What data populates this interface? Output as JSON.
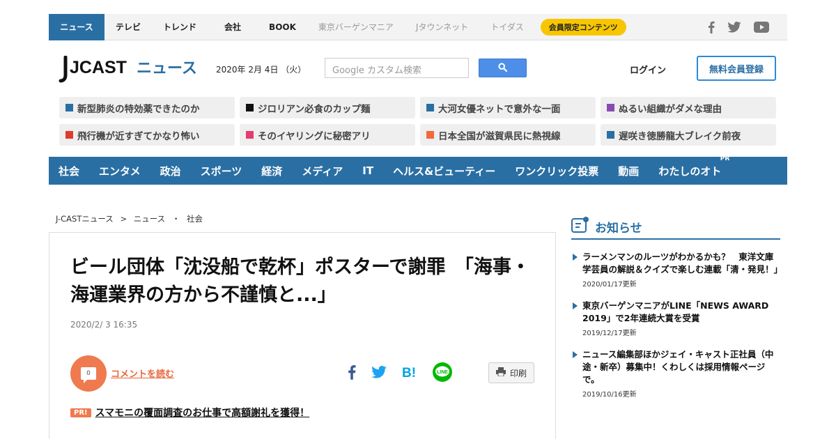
{
  "topnav": {
    "items": [
      {
        "label": "ニュース"
      },
      {
        "label": "テレビ"
      },
      {
        "label": "トレンド"
      },
      {
        "label": "会社"
      },
      {
        "label": "BOOK"
      },
      {
        "label": "東京バーゲンマニア"
      },
      {
        "label": "Jタウンネット"
      },
      {
        "label": "トイダス"
      }
    ],
    "members_label": "会員限定コンテンツ"
  },
  "header": {
    "logo_text": "JCAST",
    "logo_sub": "ニュース",
    "date": "2020年 2月 4日 （火）",
    "search_placeholder": "Google カスタム検索",
    "login_label": "ログイン",
    "signup_label": "無料会員登録"
  },
  "chips": [
    {
      "label": "新型肺炎の特効薬できたのか",
      "color": "#2a6fa4"
    },
    {
      "label": "ジロリアン必食のカップ麺",
      "color": "#111111"
    },
    {
      "label": "大河女優ネットで意外な一面",
      "color": "#2a6fa4"
    },
    {
      "label": "ぬるい組織がダメな理由",
      "color": "#8a4bb5"
    },
    {
      "label": "飛行機が近すぎてかなり怖い",
      "color": "#e03a2f"
    },
    {
      "label": "そのイヤリングに秘密アリ",
      "color": "#e63b6f"
    },
    {
      "label": "日本全国が滋賀県民に熱視線",
      "color": "#f06a3a"
    },
    {
      "label": "遅咲き徳勝龍大ブレイク前夜",
      "color": "#2a6fa4"
    }
  ],
  "categories": [
    {
      "label": "社会"
    },
    {
      "label": "エンタメ"
    },
    {
      "label": "政治"
    },
    {
      "label": "スポーツ"
    },
    {
      "label": "経済"
    },
    {
      "label": "メディア"
    },
    {
      "label": "IT"
    },
    {
      "label": "ヘルス&ビューティー"
    },
    {
      "label": "ワンクリック投票"
    },
    {
      "label": "動画"
    },
    {
      "label": "わたしのオト"
    }
  ],
  "category_pr": "PR",
  "breadcrumb": [
    "J-CASTニュース",
    ">",
    "ニュース",
    "・",
    "社会"
  ],
  "article": {
    "headline": "ビール団体「沈没船で乾杯」ポスターで謝罪　「海事・海運業界の方から不謹慎と...」",
    "date": "2020/2/ 3 16:35",
    "comment_count": "0",
    "comment_link": "コメントを読む",
    "print_label": "印刷",
    "pr_badge": "PR!",
    "pr_text": "スマモニの覆面調査のお仕事で高額謝礼を獲得！"
  },
  "notices": {
    "title": "お知らせ",
    "items": [
      {
        "text": "ラーメンマンのルーツがわかるかも？　東洋文庫学芸員の解説＆クイズで楽しむ連載「清・発見！」",
        "updated": "2020/01/17更新"
      },
      {
        "text": "東京バーゲンマニアがLINE「NEWS AWARD 2019」で2年連続大賞を受賞",
        "updated": "2019/12/17更新"
      },
      {
        "text": "ニュース編集部ほかジェイ・キャスト正社員（中途・新卒）募集中！くわしくは採用情報ページで。",
        "updated": "2019/10/16更新"
      }
    ]
  },
  "colors": {
    "brand_blue": "#2a6fa4",
    "accent_orange": "#f07a4f",
    "members_yellow": "#f7c600"
  }
}
